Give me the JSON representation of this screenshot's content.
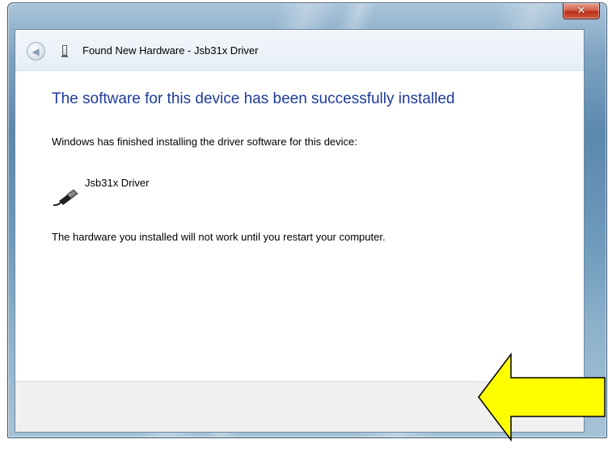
{
  "window": {
    "title": "Found New Hardware - Jsb31x Driver",
    "close_glyph": "✕"
  },
  "nav": {
    "back_glyph": "◀"
  },
  "content": {
    "heading": "The software for this device has been successfully installed",
    "intro": "Windows has finished installing the driver software for this device:",
    "device_name": "Jsb31x Driver",
    "device_icon": "usb-cable-icon",
    "restart_notice": "The hardware you installed will not work until you restart your computer."
  },
  "annotation": {
    "arrow_color": "#ffff00",
    "arrow_direction": "left"
  },
  "colors": {
    "heading_blue": "#1e3b9a",
    "close_red": "#c4432a"
  }
}
